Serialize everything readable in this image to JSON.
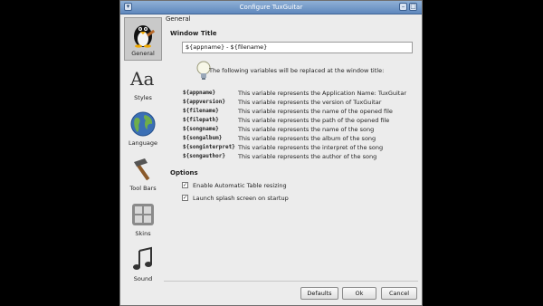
{
  "window": {
    "title": "Configure TuxGuitar",
    "menu_glyph": "▾",
    "minimize_glyph": "–",
    "maximize_glyph": "□"
  },
  "sidebar": {
    "items": [
      {
        "label": "General",
        "icon": "tux-icon",
        "selected": true
      },
      {
        "label": "Styles",
        "icon": "font-icon",
        "selected": false
      },
      {
        "label": "Language",
        "icon": "globe-icon",
        "selected": false
      },
      {
        "label": "Tool Bars",
        "icon": "hammer-icon",
        "selected": false
      },
      {
        "label": "Skins",
        "icon": "skin-grid-icon",
        "selected": false
      },
      {
        "label": "Sound",
        "icon": "music-note-icon",
        "selected": false
      }
    ]
  },
  "general": {
    "group_label": "General",
    "window_title_label": "Window Title",
    "window_title_value": "${appname} - ${filename}",
    "intro_text": "The following variables will be replaced at the window title:",
    "variables": [
      {
        "name": "${appname}",
        "desc": "This variable represents the Application Name: TuxGuitar"
      },
      {
        "name": "${appversion}",
        "desc": "This variable represents the version of TuxGuitar"
      },
      {
        "name": "${filename}",
        "desc": "This variable represents the name of the opened file"
      },
      {
        "name": "${filepath}",
        "desc": "This variable represents the path of the opened file"
      },
      {
        "name": "${songname}",
        "desc": "This variable represents the name of the song"
      },
      {
        "name": "${songalbum}",
        "desc": "This variable represents the album of the song"
      },
      {
        "name": "${songinterpret}",
        "desc": "This variable represents the interpret of the song"
      },
      {
        "name": "${songauthor}",
        "desc": "This variable represents the author of the song"
      }
    ],
    "options_label": "Options",
    "options": [
      {
        "label": "Enable Automatic Table resizing",
        "checked": true
      },
      {
        "label": "Launch splash screen on startup",
        "checked": true
      }
    ]
  },
  "buttons": {
    "defaults": "Defaults",
    "ok": "Ok",
    "cancel": "Cancel"
  },
  "colors": {
    "titlebar": "#5f88bd",
    "dialog_bg": "#ececec",
    "background": "#000000"
  }
}
